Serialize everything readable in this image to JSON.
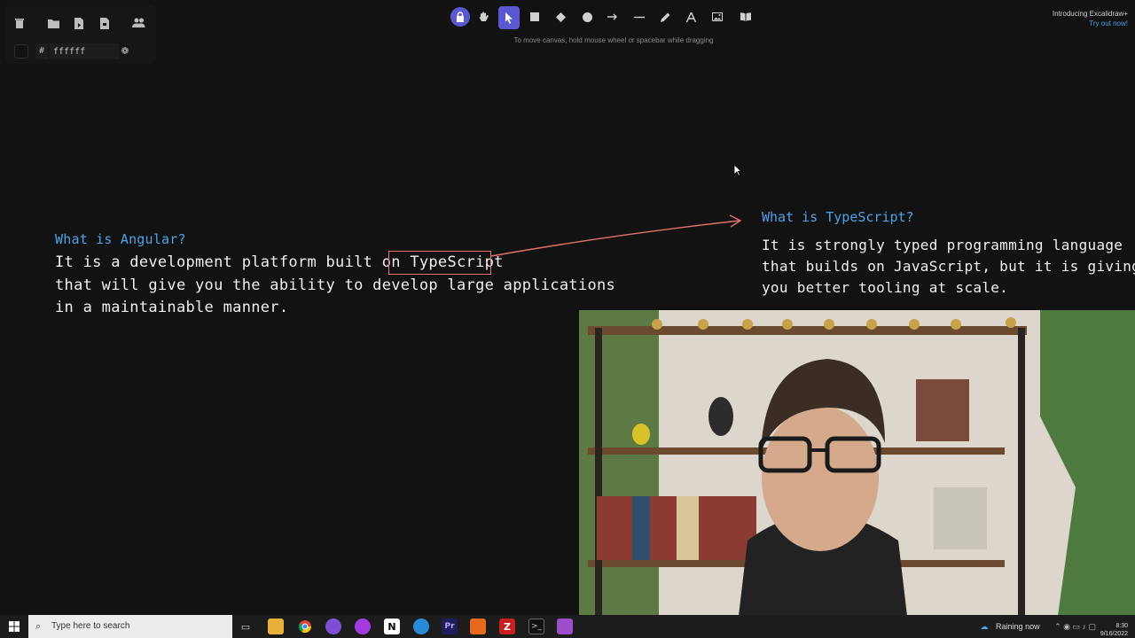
{
  "left_panel": {
    "hash": "#",
    "hex_value": "ffffff",
    "icons": [
      "trash-icon",
      "open-folder-icon",
      "save-icon",
      "export-icon",
      "collaborate-icon"
    ]
  },
  "toolbar": {
    "tools": [
      "lock-icon",
      "hand-icon",
      "selection-icon",
      "rectangle-icon",
      "diamond-icon",
      "ellipse-icon",
      "arrow-icon",
      "line-icon",
      "pencil-icon",
      "text-icon",
      "image-icon",
      "library-icon"
    ],
    "hint": "To move canvas, hold mouse wheel or spacebar while dragging"
  },
  "promo": {
    "line1": "Introducing Excalidraw+",
    "line2": "Try out now!"
  },
  "canvas": {
    "angular_question": "What is Angular?",
    "angular_lines": [
      "It is a development platform built on TypeScript",
      "that will give you the ability to develop large applications",
      "in a maintainable manner."
    ],
    "typescript_question": "What is TypeScript?",
    "typescript_lines": [
      "It is strongly typed programming language",
      "that builds on JavaScript, but it is giving",
      "you better tooling at scale."
    ],
    "colors": {
      "question": "#4da3e8",
      "body": "#f0f0f0",
      "highlight": "#e0736f",
      "background": "#121212"
    }
  },
  "taskbar": {
    "search_placeholder": "Type here to search",
    "weather": "Raining now",
    "date": "9/16/2022",
    "clock_short": "8:30"
  }
}
